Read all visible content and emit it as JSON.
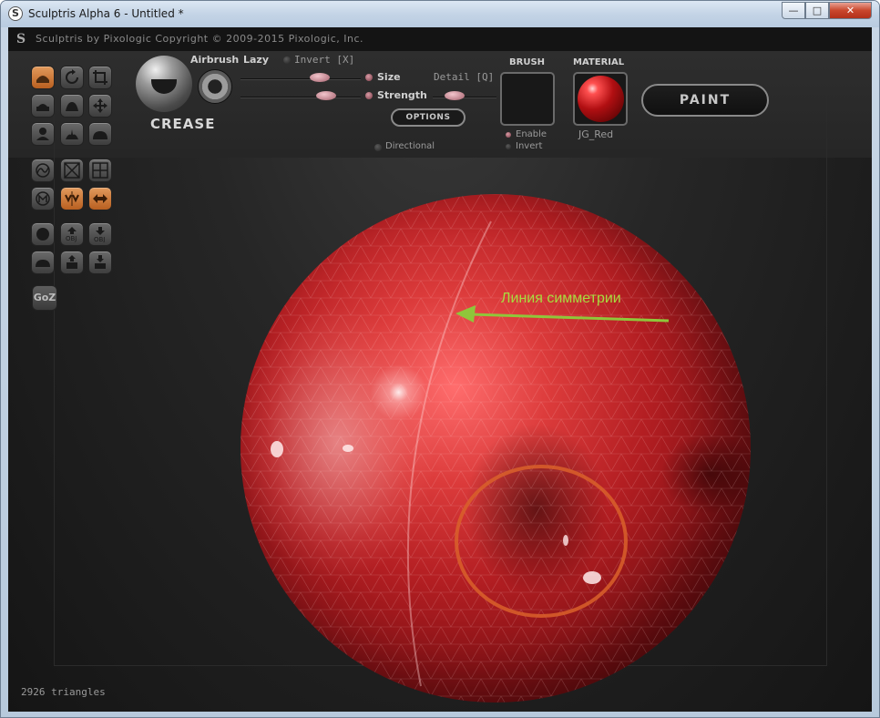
{
  "window": {
    "title": "Sculptris Alpha 6 - Untitled *",
    "app_icon": "sculptris-app-icon",
    "controls": {
      "minimize": "—",
      "maximize": "□",
      "close": "✕"
    }
  },
  "header": {
    "logo_icon": "S",
    "copyright": "Sculptris by Pixologic   Copyright © 2009-2015 Pixologic, Inc."
  },
  "brush": {
    "name": "CREASE",
    "airbrush_label": "Airbrush",
    "lazy_label": "Lazy",
    "invert_label": "Invert [X]",
    "size_label": "Size",
    "strength_label": "Strength",
    "detail_label": "Detail [Q]",
    "options_label": "OPTIONS",
    "directional_label": "Directional",
    "brush_section_label": "BRUSH",
    "enable_label": "Enable",
    "invert_small_label": "Invert",
    "material_section_label": "MATERIAL",
    "material_name": "JG_Red",
    "paint_label": "PAINT"
  },
  "viewport": {
    "annotation": "Линия симметрии",
    "annotation_color": "#a8dc3e",
    "brush_ring_color": "#d9602a",
    "mesh_color": "#b31e22"
  },
  "status": {
    "triangles": "2926 triangles"
  },
  "colors": {
    "active_tool": "#d67a35",
    "slider_knob": "#e8b4bc"
  }
}
